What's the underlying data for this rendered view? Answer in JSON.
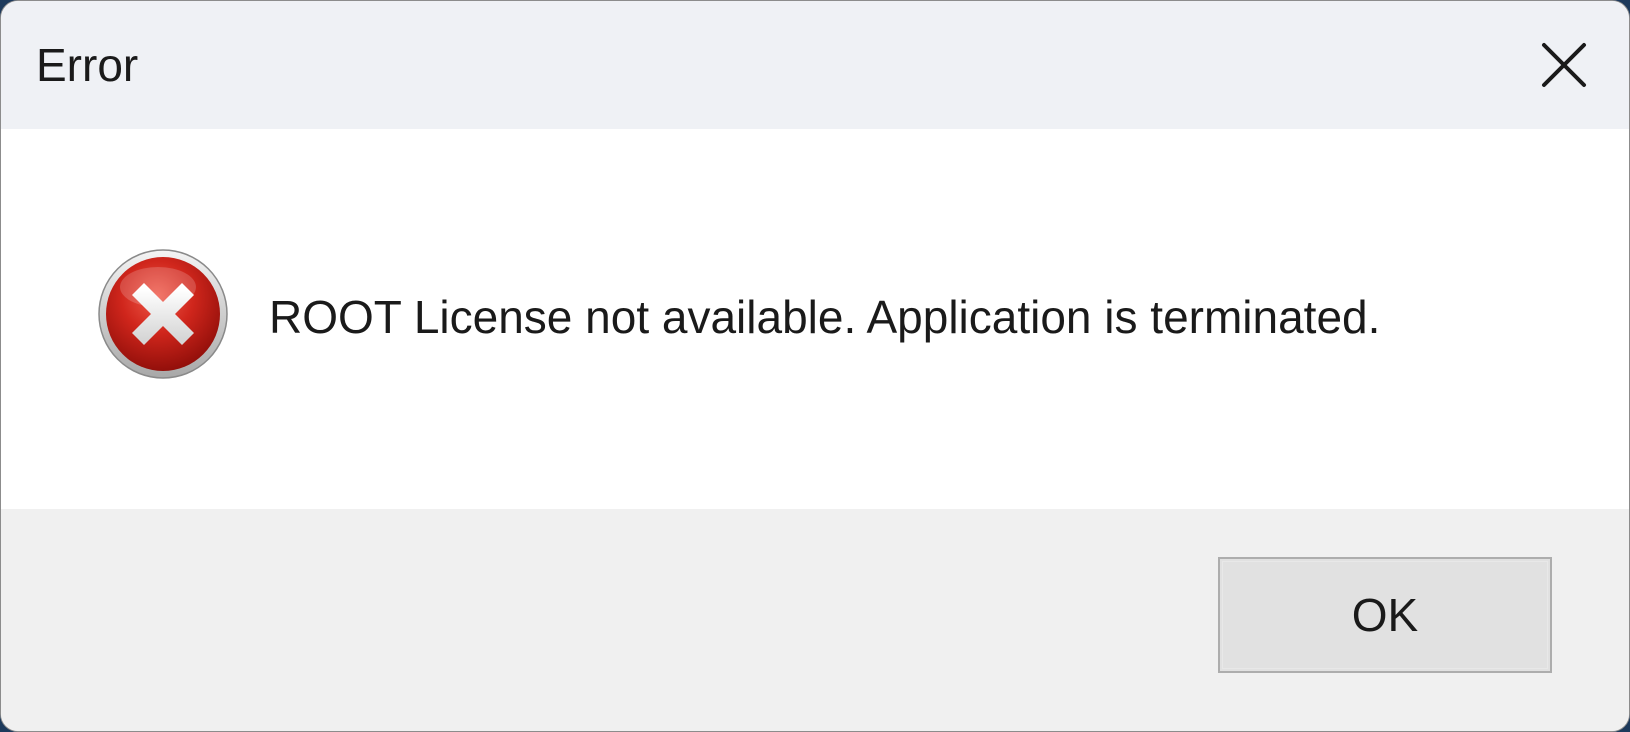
{
  "window": {
    "title": "Error",
    "close_icon": "close-icon"
  },
  "content": {
    "icon": "error-icon",
    "message": "ROOT License not available. Application is terminated."
  },
  "footer": {
    "ok_label": "OK"
  },
  "colors": {
    "titlebar": "#eff1f5",
    "content": "#ffffff",
    "footer": "#f0f0f0",
    "button": "#e1e1e1",
    "error_red": "#c81e1e"
  }
}
